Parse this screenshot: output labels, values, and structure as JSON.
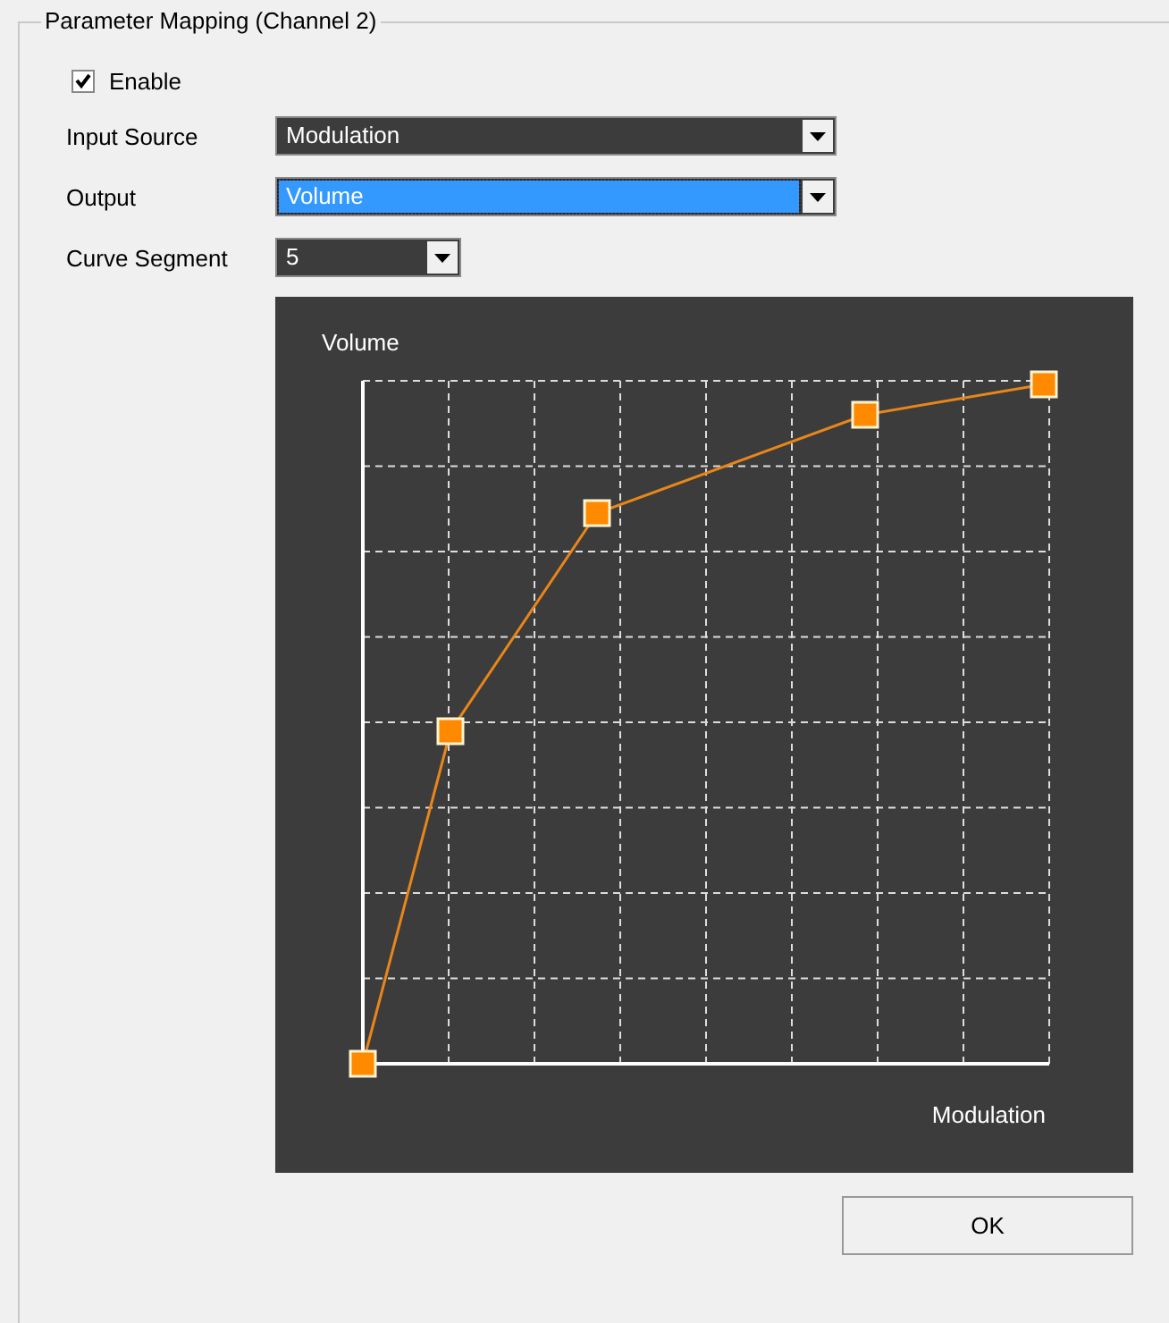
{
  "group": {
    "title": "Parameter Mapping (Channel 2)"
  },
  "enable": {
    "label": "Enable",
    "checked": true
  },
  "fields": [
    {
      "label": "Input Source",
      "value": "Modulation",
      "focused": false,
      "kind": "wide"
    },
    {
      "label": "Output",
      "value": "Volume",
      "focused": true,
      "kind": "wide"
    },
    {
      "label": "Curve Segment",
      "value": "5",
      "focused": false,
      "kind": "narrow"
    }
  ],
  "graph": {
    "y_label": "Volume",
    "x_label": "Modulation"
  },
  "buttons": [
    "OK"
  ]
}
